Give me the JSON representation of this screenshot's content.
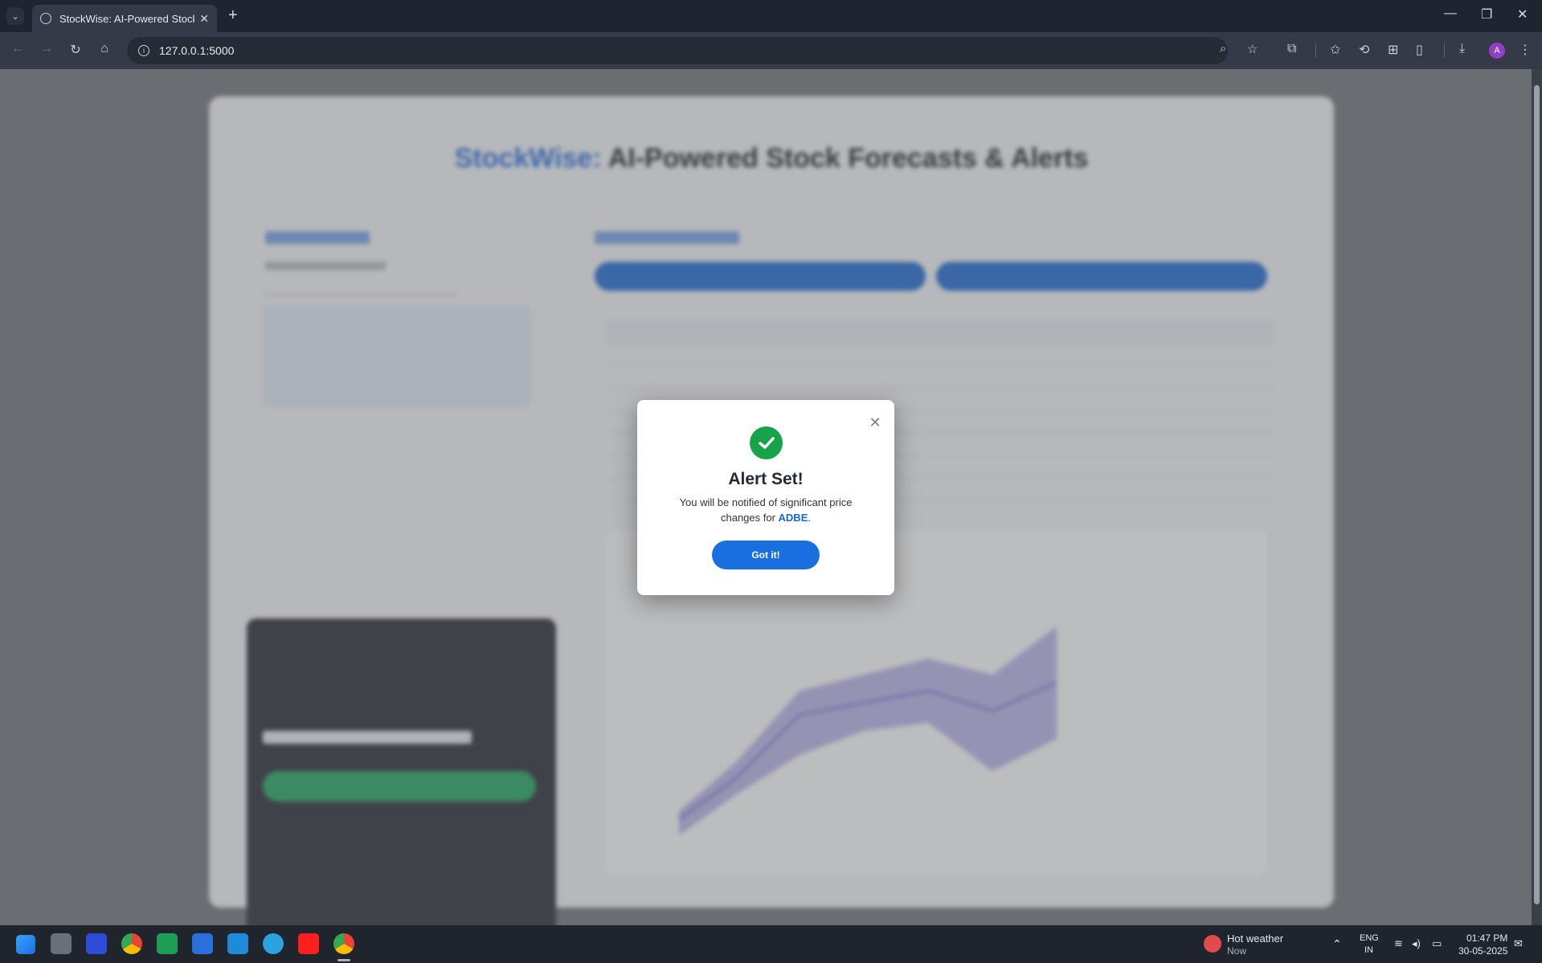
{
  "browser": {
    "tab_title": "StockWise: AI-Powered Stock Fo",
    "url": "127.0.0.1:5000",
    "profile_initial": "A"
  },
  "page": {
    "brand": "StockWise:",
    "title_rest": " AI-Powered Stock Forecasts & Alerts"
  },
  "modal": {
    "title": "Alert Set!",
    "message_prefix": "You will be notified of significant price changes for ",
    "ticker": "ADBE",
    "message_suffix": ".",
    "button_label": "Got it!"
  },
  "taskbar": {
    "weather_title": "Hot weather",
    "weather_sub": "Now",
    "lang_top": "ENG",
    "lang_bottom": "IN",
    "time": "01:47 PM",
    "date": "30-05-2025"
  },
  "colors": {
    "brand_blue": "#1b66d6",
    "success_green": "#16a34a",
    "button_blue": "#1a6fe0"
  },
  "icons": [
    "tab-list-icon",
    "globe-icon",
    "close-icon",
    "plus-icon",
    "minimize-icon",
    "restore-icon",
    "back-icon",
    "forward-icon",
    "reload-icon",
    "home-icon",
    "info-icon",
    "zoom-icon",
    "star-icon",
    "extensions-icon",
    "favorites-icon",
    "history-icon",
    "split-icon",
    "reading-icon",
    "download-icon",
    "more-icon",
    "check-icon"
  ]
}
